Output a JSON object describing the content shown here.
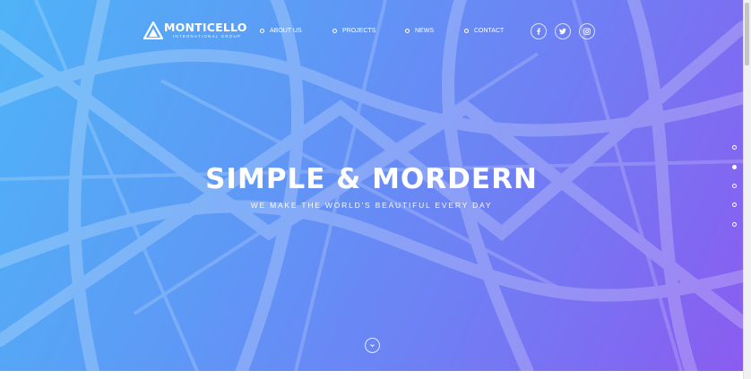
{
  "brand": {
    "name": "MONTICELLO",
    "tagline": "INTERNATIONAL GROUP"
  },
  "nav": {
    "items": [
      {
        "label": "ABOUT US"
      },
      {
        "label": "PROJECTS"
      },
      {
        "label": "NEWS"
      },
      {
        "label": "CONTACT"
      }
    ]
  },
  "social": {
    "icons": [
      "facebook-icon",
      "twitter-icon",
      "instagram-icon"
    ]
  },
  "hero": {
    "title": "SIMPLE & MORDERN",
    "subtitle": "WE MAKE THE WORLD'S BEAUTIFUL EVERY DAY",
    "gradient": [
      "#4fb3f7",
      "#5d9af6",
      "#6f7ff4",
      "#8a5cf0"
    ]
  },
  "slider": {
    "count": 5,
    "active_index": 1
  },
  "scroll_indicator": {
    "icon": "chevron-down-icon"
  }
}
